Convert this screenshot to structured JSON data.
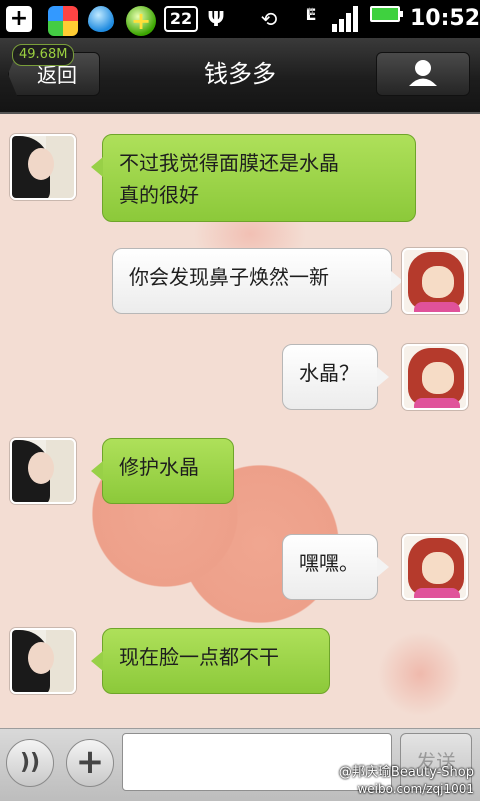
{
  "status_bar": {
    "notification_count": "22",
    "network_type": "E",
    "time": "10:52",
    "icons": [
      "plus-icon",
      "app-icon",
      "water-drop-icon",
      "green-plus-icon",
      "usb-icon",
      "rotation-icon",
      "signal-icon",
      "battery-icon"
    ]
  },
  "header": {
    "memory_badge": "49.68M",
    "back_label": "返回",
    "title": "钱多多",
    "profile_icon": "person-icon"
  },
  "messages": [
    {
      "sender": "friend",
      "text_lines": [
        "不过我觉得面膜还是水晶",
        "真的很好"
      ]
    },
    {
      "sender": "me",
      "text_lines": [
        "你会发现鼻子焕然一新"
      ]
    },
    {
      "sender": "me",
      "text_lines": [
        "水晶？"
      ]
    },
    {
      "sender": "friend",
      "text_lines": [
        "修护水晶"
      ]
    },
    {
      "sender": "me",
      "text_lines": [
        "嘿嘿。"
      ]
    },
    {
      "sender": "friend",
      "text_lines": [
        "现在脸一点都不干"
      ]
    }
  ],
  "input_bar": {
    "voice_icon": "voice-icon",
    "plus_icon": "plus-icon",
    "input_value": "",
    "send_label": "发送"
  },
  "watermark": {
    "line1": "@邦庆瑜Beauty-Shop",
    "line2": "weibo.com/zqj1001"
  },
  "colors": {
    "friend_bubble": "#9bd04a",
    "my_bubble": "#ffffff",
    "header_bg": "#1d1d1d",
    "chat_bg": "#f3ddd3"
  }
}
